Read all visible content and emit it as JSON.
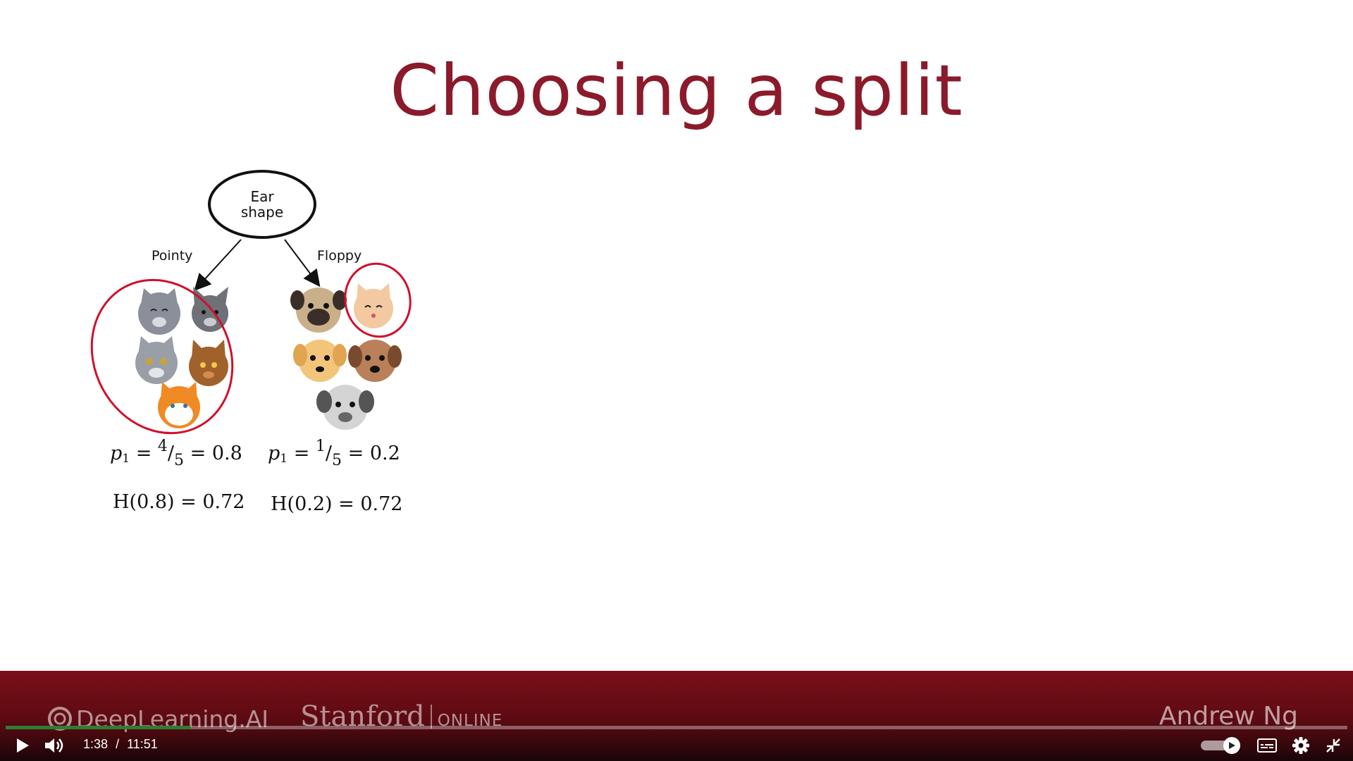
{
  "slide": {
    "title": "Choosing a split",
    "root_node": {
      "line1": "Ear",
      "line2": "shape"
    },
    "branches": [
      {
        "label": "Pointy",
        "p_text": "p",
        "p_sub": "1",
        "frac_num": "4",
        "frac_den": "5",
        "p_value": "0.8",
        "h_text": "H(0.8) = 0.72"
      },
      {
        "label": "Floppy",
        "p_text": "p",
        "p_sub": "1",
        "frac_num": "1",
        "frac_den": "5",
        "p_value": "0.2",
        "h_text": "H(0.2) = 0.72"
      }
    ],
    "animals_left": [
      "cat",
      "cat",
      "cat",
      "cat",
      "cat"
    ],
    "animals_right": [
      "cat",
      "dog",
      "dog",
      "dog",
      "dog"
    ]
  },
  "banner": {
    "logo_left": "DeepLearning.AI",
    "logo_stanford": "Stanford",
    "logo_online": "ONLINE",
    "author": "Andrew Ng",
    "color": "#7b0f18"
  },
  "player": {
    "current_time": "1:38",
    "separator": "/",
    "duration": "11:51",
    "progress_fraction": 0.138,
    "icons": [
      "play-icon",
      "volume-icon",
      "autoplay-toggle",
      "captions-icon",
      "settings-icon",
      "exit-fullscreen-icon"
    ],
    "accent": "#2e7d32"
  }
}
